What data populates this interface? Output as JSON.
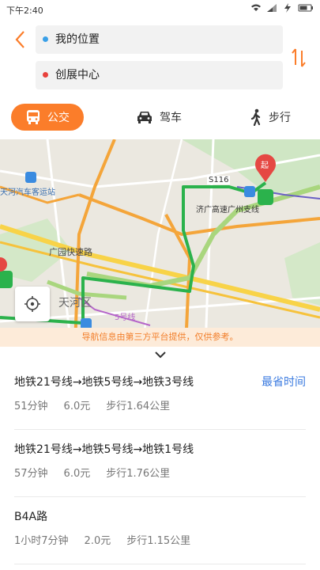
{
  "status_bar": {
    "time": "下午2:40"
  },
  "route_input": {
    "origin": "我的位置",
    "destination": "创展中心",
    "origin_color": "#3aa0e8",
    "destination_color": "#e8413c"
  },
  "modes": [
    {
      "label": "公交",
      "icon": "bus-icon",
      "active": true
    },
    {
      "label": "驾车",
      "icon": "car-icon",
      "active": false
    },
    {
      "label": "步行",
      "icon": "walk-icon",
      "active": false
    }
  ],
  "map": {
    "labels": {
      "station": "天河汽车客运站",
      "road_code": "S116",
      "expressway": "广园快速路",
      "district": "天河区",
      "line5": "5号线",
      "branch": "济广高速广州支线"
    },
    "start_marker": "起",
    "notice": "导航信息由第三方平台提供，仅供参考。",
    "route_color": "#2bb24c",
    "accent_color": "#fb7d2a"
  },
  "routes": [
    {
      "title": "地铁21号线→地铁5号线→地铁3号线",
      "tag": "最省时间",
      "duration": "51分钟",
      "price": "6.0元",
      "walk": "步行1.64公里"
    },
    {
      "title": "地铁21号线→地铁5号线→地铁1号线",
      "tag": "",
      "duration": "57分钟",
      "price": "6.0元",
      "walk": "步行1.76公里"
    },
    {
      "title": "B4A路",
      "tag": "",
      "duration": "1小时7分钟",
      "price": "2.0元",
      "walk": "步行1.15公里"
    }
  ]
}
